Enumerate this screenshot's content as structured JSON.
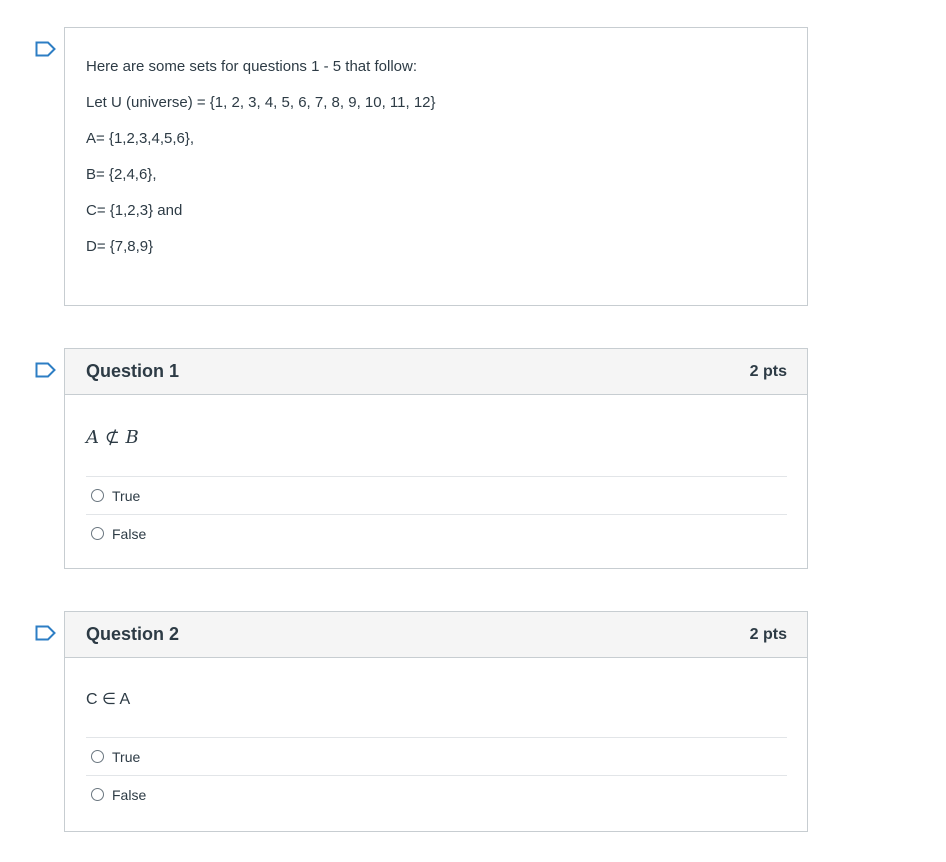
{
  "intro": {
    "lines": [
      "Here are some sets for questions 1 - 5 that follow:",
      "Let U (universe) = {1, 2, 3, 4, 5, 6, 7, 8, 9, 10, 11, 12}",
      "A= {1,2,3,4,5,6},",
      "B= {2,4,6},",
      "C= {1,2,3} and",
      "D= {7,8,9}"
    ]
  },
  "questions": [
    {
      "title": "Question 1",
      "points": "2 pts",
      "text": "A ⊄ B",
      "answers": [
        "True",
        "False"
      ]
    },
    {
      "title": "Question 2",
      "points": "2 pts",
      "text": "C ∈ A",
      "answers": [
        "True",
        "False"
      ]
    }
  ],
  "icons": {
    "flag": "flag-outline-icon"
  },
  "colors": {
    "flag": "#2d7ec4",
    "border": "#c7cdd1",
    "header_bg": "#f5f5f5",
    "text": "#2d3b45"
  }
}
